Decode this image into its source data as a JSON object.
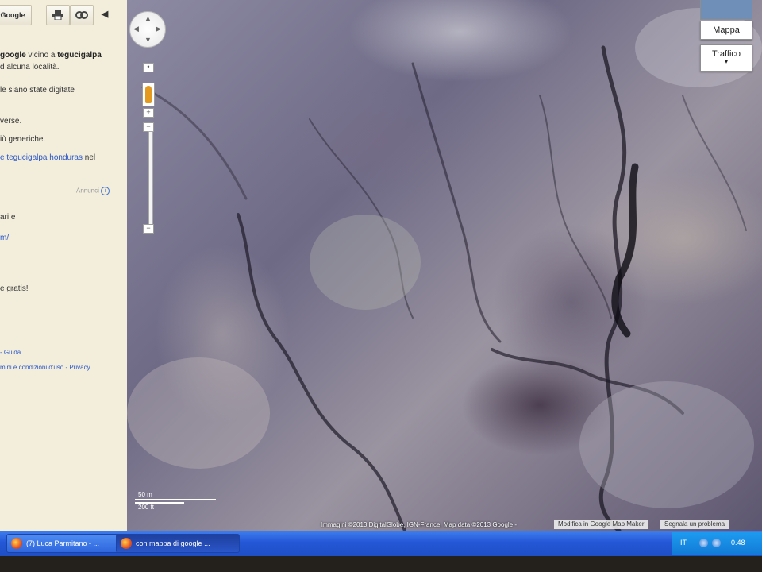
{
  "sidebar": {
    "toolbar": {
      "search_link_label": "Google",
      "print_icon": "printer-icon",
      "link_icon": "link-icon",
      "collapse_icon": "chevron-left-icon"
    },
    "result_line1_pre": "google",
    "result_line1_mid": " vicino a ",
    "result_line1_post": "tegucigalpa",
    "result_line2": "d alcuna località.",
    "tip_line1": "le siano state digitate",
    "tip_line2": "verse.",
    "tip_line3": "iù generiche.",
    "suggest_link": "e tegucigalpa honduras",
    "suggest_suffix": " nel",
    "ad_label": "Annunci",
    "ad_line1": "ari e",
    "ad_link": "m/",
    "ad_line2": "e gratis!",
    "footer_links": "- Guida",
    "footer_terms": "mini e condizioni d'uso - Privacy"
  },
  "map": {
    "zoom_in_label": "+",
    "zoom_out_label": "−",
    "map_type_label": "Mappa",
    "traffic_label": "Traffico",
    "traffic_chevron": "▾",
    "scale_top": "50 m",
    "scale_bottom": "200 ft",
    "attribution": "Immagini ©2013 DigitalGlobe, IGN-France, Map data ©2013 Google -",
    "edit_map_label": "Modifica in Google Map Maker",
    "report_label": "Segnala un problema"
  },
  "taskbar": {
    "tasks": [
      {
        "label": "(7) Luca Parmitano - ..."
      },
      {
        "label": "con mappa di google ..."
      }
    ],
    "tray": {
      "language": "IT",
      "clock": "0.48"
    }
  },
  "colors": {
    "link_blue": "#2a56c6",
    "taskbar_blue": "#2457d6",
    "panel_bg": "#f3eedc"
  }
}
